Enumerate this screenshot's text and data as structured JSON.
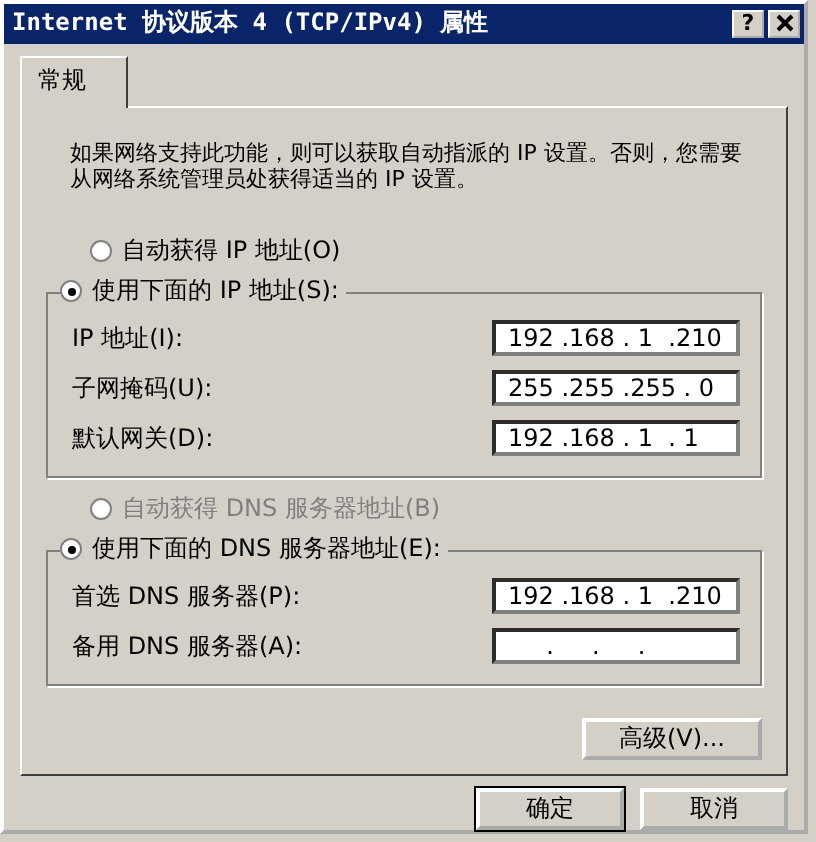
{
  "window": {
    "title": "Internet 协议版本 4 (TCP/IPv4) 属性",
    "help": "?"
  },
  "tabs": [
    {
      "label": "常规",
      "selected": true
    }
  ],
  "description": "如果网络支持此功能，则可以获取自动指派的 IP 设置。否则，您需要从网络系统管理员处获得适当的 IP 设置。",
  "sections": [
    {
      "auto_radio": {
        "label": "自动获得 IP 地址(O)",
        "selected": false,
        "disabled": false
      },
      "manual_radio": {
        "label": "使用下面的 IP 地址(S):",
        "selected": true,
        "disabled": false
      },
      "fields": [
        {
          "label": "IP 地址(I):",
          "value": "192 .168 . 1  .210"
        },
        {
          "label": "子网掩码(U):",
          "value": "255 .255 .255 . 0"
        },
        {
          "label": "默认网关(D):",
          "value": "192 .168 . 1  . 1"
        }
      ]
    },
    {
      "auto_radio": {
        "label": "自动获得 DNS 服务器地址(B)",
        "selected": false,
        "disabled": true
      },
      "manual_radio": {
        "label": "使用下面的 DNS 服务器地址(E):",
        "selected": true,
        "disabled": false
      },
      "fields": [
        {
          "label": "首选 DNS 服务器(P):",
          "value": "192 .168 . 1  .210"
        },
        {
          "label": "备用 DNS 服务器(A):",
          "value": "     .     .     ."
        }
      ]
    }
  ],
  "advanced_button": "高级(V)...",
  "buttons": [
    "确定",
    "取消"
  ]
}
